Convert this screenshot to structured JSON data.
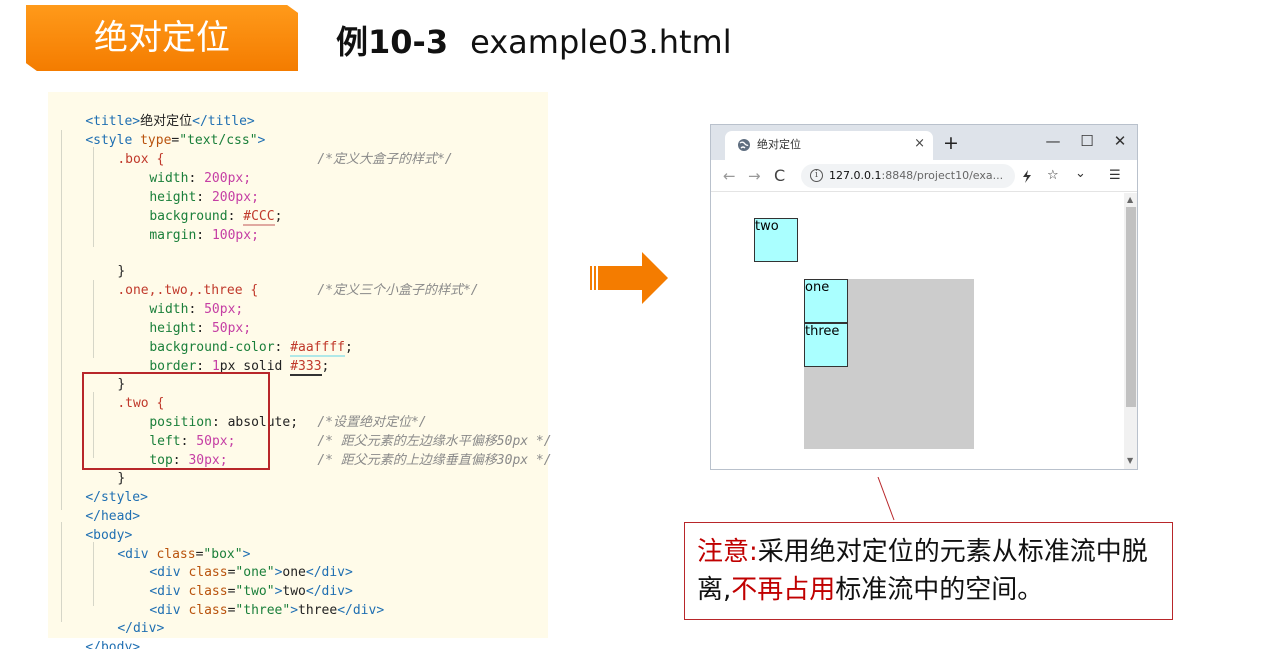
{
  "header": {
    "banner_label": "绝对定位",
    "example_number": "例10-3",
    "example_file": "example03.html"
  },
  "code": {
    "lines": [
      [
        "<title>",
        "绝对定位",
        "</title>"
      ],
      [
        "<style ",
        "type",
        "=",
        "\"text/css\"",
        ">"
      ],
      [
        ".box {",
        "/*定义大盒子的样式*/"
      ],
      [
        "width",
        ": ",
        "200",
        "px;"
      ],
      [
        "height",
        ": ",
        "200",
        "px;"
      ],
      [
        "background",
        ": ",
        "#CCC",
        ";"
      ],
      [
        "margin",
        ": ",
        "100",
        "px;"
      ],
      [
        "}"
      ],
      [
        ".one,.two,.three {",
        "/*定义三个小盒子的样式*/"
      ],
      [
        "width",
        ": ",
        "50",
        "px;"
      ],
      [
        "height",
        ": ",
        "50",
        "px;"
      ],
      [
        "background-color",
        ": ",
        "#aaffff",
        ";"
      ],
      [
        "border",
        ": ",
        "1",
        "px solid ",
        "#333",
        ";"
      ],
      [
        "}"
      ],
      [
        ".two {"
      ],
      [
        "position",
        ": absolute;",
        "/*设置绝对定位*/"
      ],
      [
        "left",
        ": ",
        "50",
        "px;",
        "/* 距父元素的左边缘水平偏移50px */"
      ],
      [
        "top",
        ": ",
        "30",
        "px;",
        "/* 距父元素的上边缘垂直偏移30px */"
      ],
      [
        "}"
      ],
      [
        "</style>"
      ],
      [
        "</head>"
      ],
      [
        "<body>"
      ],
      [
        "<div ",
        "class",
        "=",
        "\"box\"",
        ">"
      ],
      [
        "<div ",
        "class",
        "=",
        "\"one\"",
        ">",
        "one",
        "</div>"
      ],
      [
        "<div ",
        "class",
        "=",
        "\"two\"",
        ">",
        "two",
        "</div>"
      ],
      [
        "<div ",
        "class",
        "=",
        "\"three\"",
        ">",
        "three",
        "</div>"
      ],
      [
        "</div>"
      ],
      [
        "</body>"
      ]
    ]
  },
  "browser": {
    "tab_title": "绝对定位",
    "tab_close": "×",
    "new_tab": "+",
    "minimize": "—",
    "maximize": "☐",
    "close": "✕",
    "back": "←",
    "forward": "→",
    "reload": "C",
    "info": "i",
    "url_host": "127.0.0.1",
    "url_rest": ":8848/project10/exa...",
    "extension_icon": "bolt-icon",
    "bookmark": "☆",
    "dropdown": "⌄",
    "menu": "☰",
    "demo_one": "one",
    "demo_two": "two",
    "demo_three": "three"
  },
  "callout": {
    "note_label": "注意:",
    "text_part1": "采用绝对定位的元素从标准流中脱离,",
    "highlight": "不再占用",
    "text_part2": "标准流中的空间。"
  },
  "colors": {
    "banner": "#f47c00",
    "arrow": "#f47c00",
    "accent_red": "#c00000",
    "code_bg": "#fffbe9",
    "demo_box": "#cccccc",
    "demo_small": "#aaffff"
  }
}
